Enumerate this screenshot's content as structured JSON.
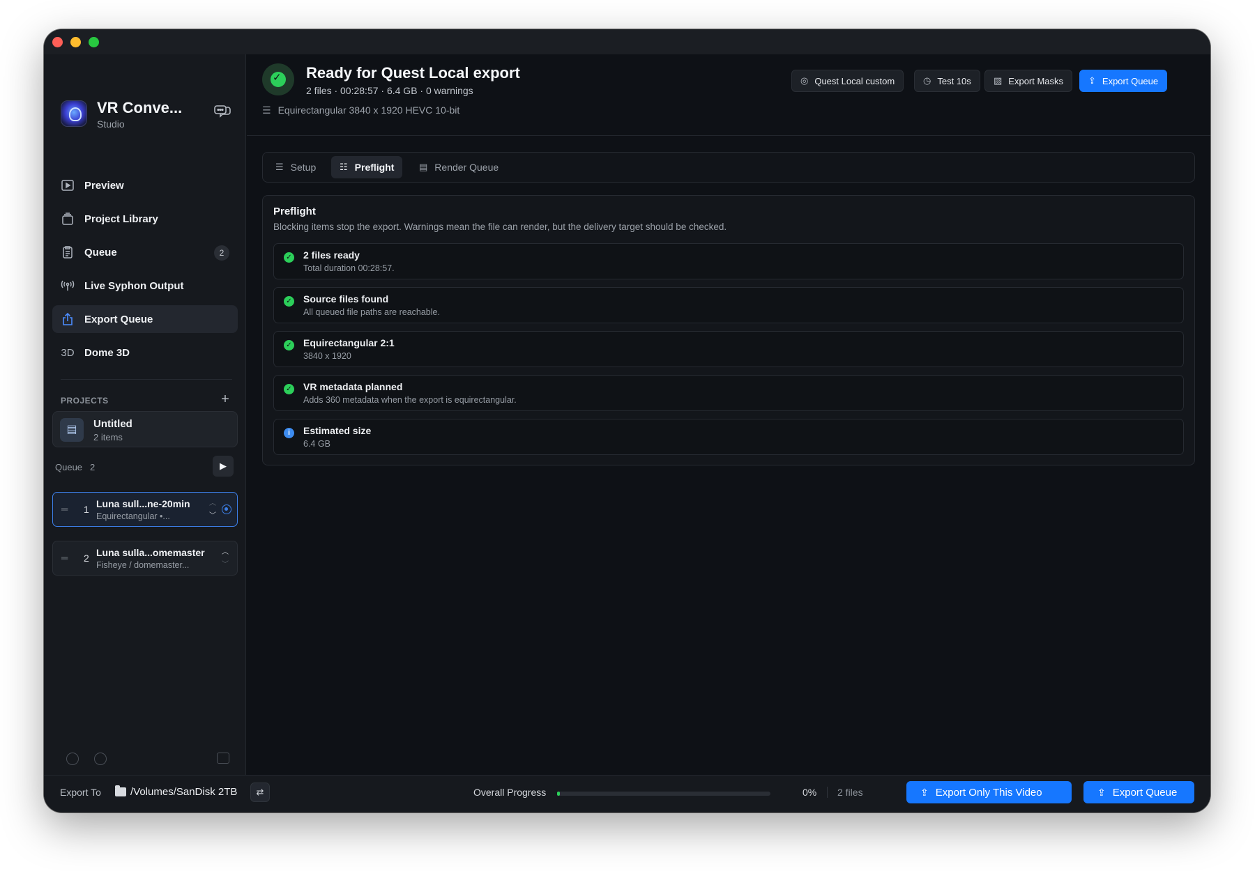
{
  "colors": {
    "accent": "#1677ff",
    "success": "#2ccf5a",
    "info": "#3d8cf0",
    "window_bg": "#0e1116",
    "sidebar_bg": "#16191e"
  },
  "app": {
    "title": "VR Conve...",
    "subtitle": "Studio",
    "logo_icon": "vr-app-logo",
    "chat_icon": "chat-bubbles-icon"
  },
  "sidebar": {
    "nav": [
      {
        "label": "Preview",
        "icon": "play-square-icon"
      },
      {
        "label": "Project Library",
        "icon": "library-icon"
      },
      {
        "label": "Queue",
        "icon": "clipboard-icon",
        "badge": "2"
      },
      {
        "label": "Live Syphon Output",
        "icon": "broadcast-icon"
      },
      {
        "label": "Export Queue",
        "icon": "share-icon",
        "active": true
      },
      {
        "label": "Dome 3D",
        "icon_text": "3D"
      }
    ],
    "projects_label": "PROJECTS",
    "project": {
      "name": "Untitled",
      "count": "2 items"
    },
    "queue_label": "Queue",
    "queue_count": "2",
    "queue_items": [
      {
        "num": "1",
        "title": "Luna sull...ne-20min",
        "sub": "Equirectangular  •...",
        "selected": true
      },
      {
        "num": "2",
        "title": "Luna sulla...omemaster",
        "sub": "Fisheye / domemaster..."
      }
    ]
  },
  "header": {
    "title": "Ready for Quest Local export",
    "meta": "2 files  ·  00:28:57  ·  6.4 GB  ·  0 warnings",
    "spec": "Equirectangular  3840 x 1920  HEVC 10-bit",
    "buttons": {
      "preset": "Quest Local custom",
      "test": "Test 10s",
      "masks": "Export Masks",
      "export": "Export Queue"
    }
  },
  "tabs": [
    {
      "label": "Setup"
    },
    {
      "label": "Preflight",
      "active": true
    },
    {
      "label": "Render Queue"
    }
  ],
  "preflight": {
    "title": "Preflight",
    "description": "Blocking items stop the export. Warnings mean the file can render, but the delivery target should be checked.",
    "checks": [
      {
        "status": "ok",
        "title": "2 files ready",
        "sub": "Total duration 00:28:57."
      },
      {
        "status": "ok",
        "title": "Source files found",
        "sub": "All queued file paths are reachable."
      },
      {
        "status": "ok",
        "title": "Equirectangular 2:1",
        "sub": "3840 x 1920"
      },
      {
        "status": "ok",
        "title": "VR metadata planned",
        "sub": "Adds 360 metadata when the export is equirectangular."
      },
      {
        "status": "info",
        "title": "Estimated size",
        "sub": "6.4 GB"
      }
    ]
  },
  "bottom": {
    "export_to_label": "Export To",
    "export_path": "/Volumes/SanDisk 2TB",
    "progress_label": "Overall Progress",
    "progress_value": 0,
    "progress_text": "0%",
    "files": "2 files",
    "export_only": "Export Only This Video",
    "export_queue": "Export Queue"
  }
}
